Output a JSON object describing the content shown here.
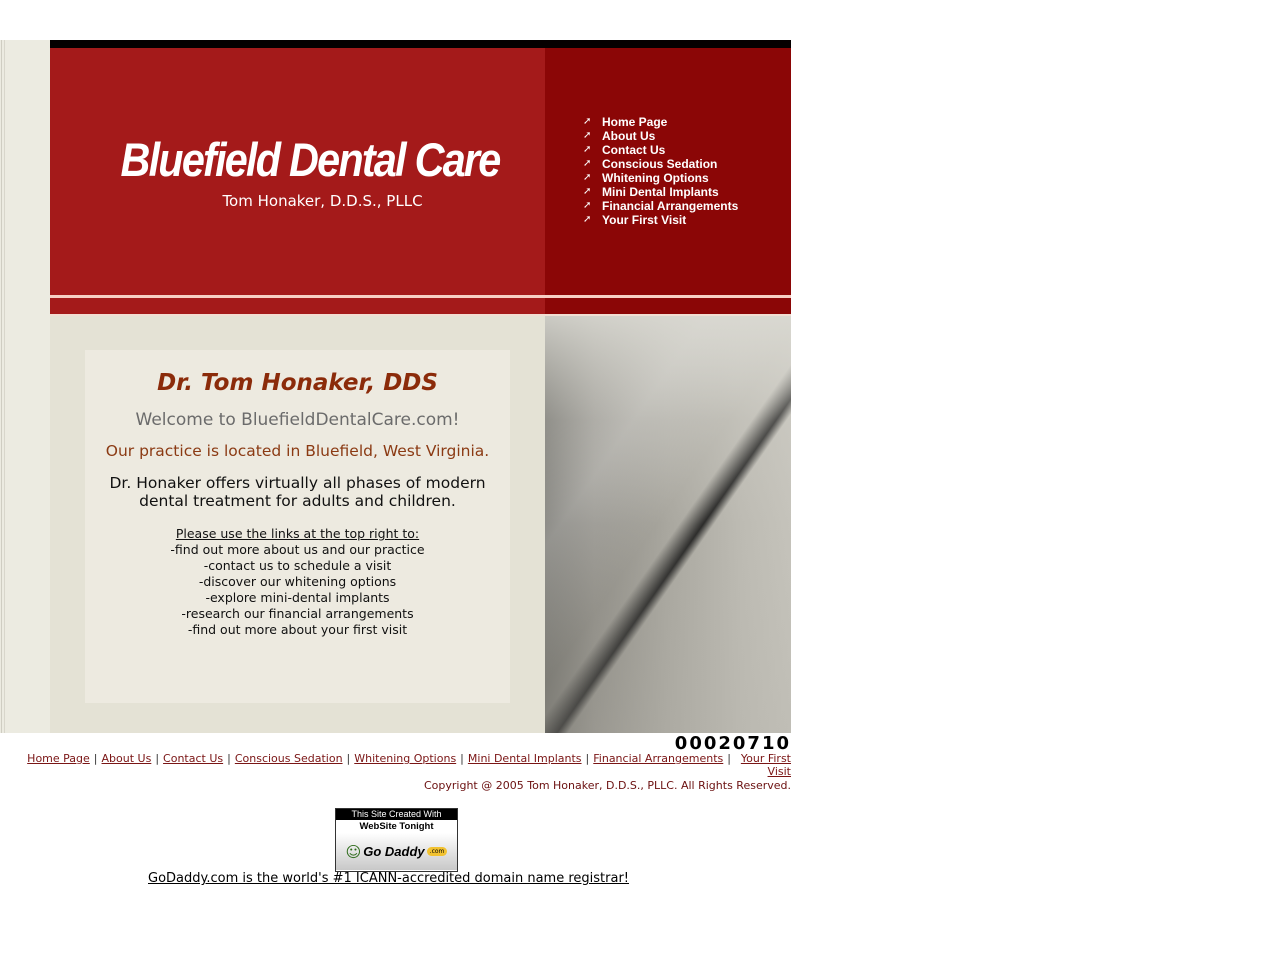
{
  "header": {
    "site_title": "Bluefield Dental Care",
    "subtitle": "Tom Honaker, D.D.S., PLLC"
  },
  "top_nav": {
    "icon": "arrow-up-right-icon",
    "items": [
      {
        "label": "Home Page"
      },
      {
        "label": "About Us"
      },
      {
        "label": "Contact Us"
      },
      {
        "label": "Conscious Sedation"
      },
      {
        "label": "Whitening Options"
      },
      {
        "label": "Mini Dental Implants"
      },
      {
        "label": "Financial Arrangements"
      },
      {
        "label": "Your First Visit"
      }
    ]
  },
  "main": {
    "title": "Dr. Tom Honaker, DDS",
    "welcome": "Welcome to BluefieldDentalCare.com!",
    "location": "Our practice is located in Bluefield, West Virginia.",
    "offers": "Dr. Honaker offers virtually all phases of modern dental treatment for adults and children.",
    "links_heading": "Please use the links at the top right to:",
    "links": [
      "-find out more about us and our practice",
      "-contact us to schedule a visit",
      "-discover our whitening options",
      "-explore mini-dental implants",
      "-research our financial arrangements",
      "-find out more about your first visit"
    ]
  },
  "counter": "00020710",
  "footer": {
    "links": [
      {
        "label": "Home Page"
      },
      {
        "label": "About Us"
      },
      {
        "label": "Contact Us"
      },
      {
        "label": "Conscious Sedation"
      },
      {
        "label": "Whitening Options"
      },
      {
        "label": "Mini Dental Implants"
      },
      {
        "label": "Financial Arrangements"
      },
      {
        "label": "Your First Visit"
      }
    ],
    "separator": "|",
    "copyright": "Copyright @ 2005 Tom Honaker, D.D.S., PLLC.  All Rights Reserved."
  },
  "badge": {
    "line1": "This Site Created With",
    "line2": "WebSite Tonight",
    "brand": "Go Daddy",
    "brand_suffix": ".com"
  },
  "registrar_link": "GoDaddy.com is the world's #1 ICANN-accredited domain name registrar!",
  "colors": {
    "header_red": "#a41a1a",
    "header_dark_red": "#8b0606",
    "title_brown": "#8b2b0a",
    "cream": "#edeae0"
  }
}
